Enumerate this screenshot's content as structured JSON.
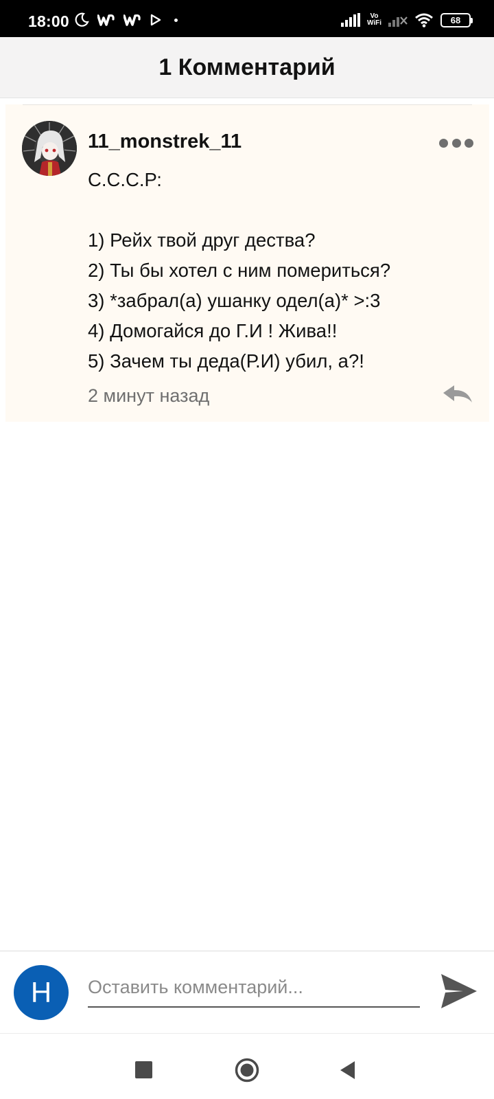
{
  "status_bar": {
    "time": "18:00",
    "battery": "68",
    "vowifi_top": "Vo",
    "vowifi_bottom": "WiFi",
    "icons": [
      "moon-icon",
      "wattpad-icon",
      "wattpad-icon",
      "play-icon",
      "dot-icon",
      "signal-icon",
      "vowifi-icon",
      "signal-off-icon",
      "wifi-icon",
      "battery-icon"
    ]
  },
  "header": {
    "title": "1 Комментарий"
  },
  "comment": {
    "username": "11_monstrek_11",
    "lines": [
      "С.С.С.Р:",
      "",
      "1) Рейх твой друг дества?",
      "2) Ты бы хотел с ним помериться?",
      "3) *забрал(а) ушанку одел(а)* >:3",
      "4) Домогайся до Г.И ! Жива!!",
      "5) Зачем ты деда(Р.И) убил, а?!"
    ],
    "timestamp": "2 минут назад"
  },
  "composer": {
    "avatar_letter": "Н",
    "placeholder": "Оставить комментарий..."
  },
  "colors": {
    "card_background": "#fffaf3",
    "user_avatar": "#0a5fb4",
    "muted_text": "#6f6f6f"
  }
}
